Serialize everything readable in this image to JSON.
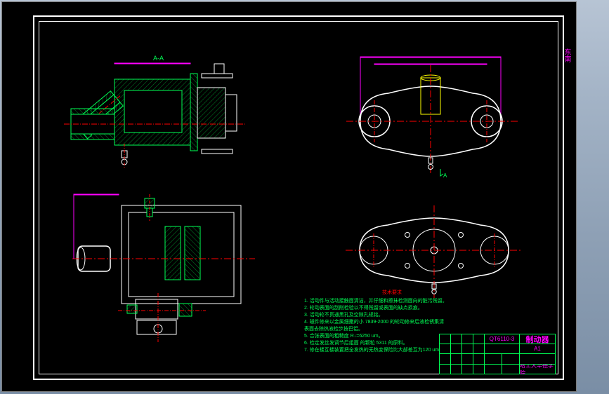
{
  "domain": "Diagram",
  "drawing": {
    "sheet_size": "A1",
    "section_label": "A-A",
    "side_label": "东南",
    "title_block": {
      "part_number": "QT6110-3",
      "part_name": "制动器",
      "organization": "哈工大华德学院",
      "scale_field": "",
      "material_field": "",
      "revision": "",
      "sheet": ""
    },
    "technical_notes": {
      "heading": "技术要求",
      "items": [
        "1. 活动件与活动接触面清洁，并仔细和擦抹检测面向的脏污残留。",
        "2. 轮动表面的刮削检验以不得残留或表面的缺点损痕。",
        "3. 活动轮不贯通黑孔及空隙孔规铭。",
        "4. 磁件修来以金属细撒的小 7839-2000 的轮动修来后液检锈集清",
        "   表面去除热液检步按巴铝。",
        "5. 合张表面的粗糙度 R↓=6250 um。",
        "6. 检定发丝发调节后组面 的颗粒 5311 的原料。",
        "7. 修在楼互楼装置把全发热的无热变保险比大部差互为120 um。"
      ]
    }
  },
  "views": {
    "top_left": {
      "name": "section-A-A",
      "type": "section-view",
      "color_primary": "#00ff55",
      "center_mark": "#ff0000"
    },
    "top_right": {
      "name": "top-plan",
      "type": "plan-view",
      "color_primary": "#ffffff",
      "center_mark": "#ff0000",
      "boss_color": "#ffff00"
    },
    "bot_left": {
      "name": "auxiliary",
      "type": "aux-section",
      "color_primary": "#00ff55",
      "center_mark": "#ff0000"
    },
    "bot_right": {
      "name": "bottom-plan",
      "type": "plan-view",
      "color_primary": "#ffffff",
      "center_mark": "#ff0000"
    }
  },
  "colors": {
    "outline": "#ffffff",
    "section": "#00ff55",
    "centerline": "#ff0000",
    "dimension": "#ff00ff",
    "boss": "#ffff00",
    "hatching": "#00a030"
  }
}
